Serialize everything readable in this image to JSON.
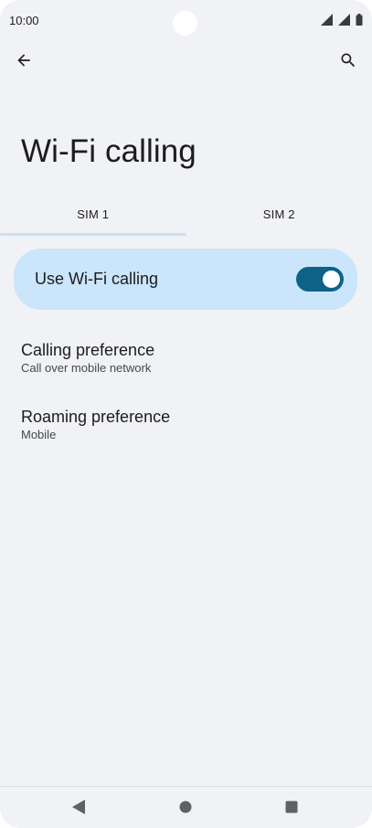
{
  "status_bar": {
    "time": "10:00"
  },
  "toolbar": {
    "back_icon": "arrow-back-icon",
    "search_icon": "search-icon"
  },
  "page": {
    "title": "Wi-Fi calling"
  },
  "tabs": [
    {
      "label": "SIM 1",
      "active": true
    },
    {
      "label": "SIM 2",
      "active": false
    }
  ],
  "wifi_calling": {
    "label": "Use Wi-Fi calling",
    "enabled": true
  },
  "preferences": [
    {
      "title": "Calling preference",
      "summary": "Call over mobile network"
    },
    {
      "title": "Roaming preference",
      "summary": "Mobile"
    }
  ],
  "colors": {
    "background": "#f1f2f6",
    "switch_row_bg": "#cbe5fa",
    "toggle_track": "#0d6288",
    "tab_indicator": "#c7e1f6",
    "text_primary": "#1c1c1e",
    "text_secondary": "#45474b"
  },
  "nav_bar": {
    "back_icon": "nav-back-triangle-icon",
    "home_icon": "nav-home-circle-icon",
    "recents_icon": "nav-recents-square-icon"
  }
}
